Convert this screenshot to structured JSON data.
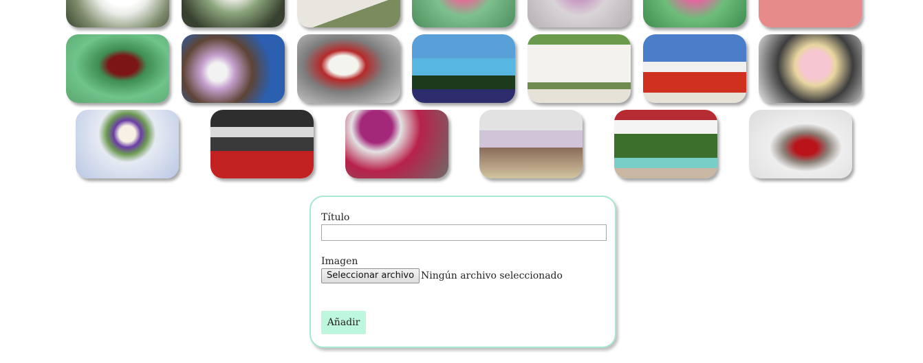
{
  "gallery": {
    "row1": [
      "white-rose-bouquet",
      "white-flower-arrangement",
      "flower-table-arrangement",
      "pink-flower-basket",
      "orchid-centerpiece",
      "pink-bouquet",
      "rose-centerpiece"
    ],
    "row2": [
      "red-feather-bouquet",
      "flower-wreath-door",
      "calla-lily-bouquet",
      "blue-tree-garden",
      "wedding-arch-garden",
      "red-carpet-aisle",
      "pink-rose-bouquet"
    ],
    "row3": [
      "candle-centerpiece",
      "church-red-carpet",
      "balloon-flower-arrangement",
      "flower-shop-interior",
      "white-rose-box",
      "red-flower-vase"
    ]
  },
  "form": {
    "title_label": "Título",
    "title_value": "",
    "image_label": "Imagen",
    "file_button_label": "Seleccionar archivo",
    "file_status": "Ningún archivo seleccionado",
    "submit_label": "Añadir"
  }
}
